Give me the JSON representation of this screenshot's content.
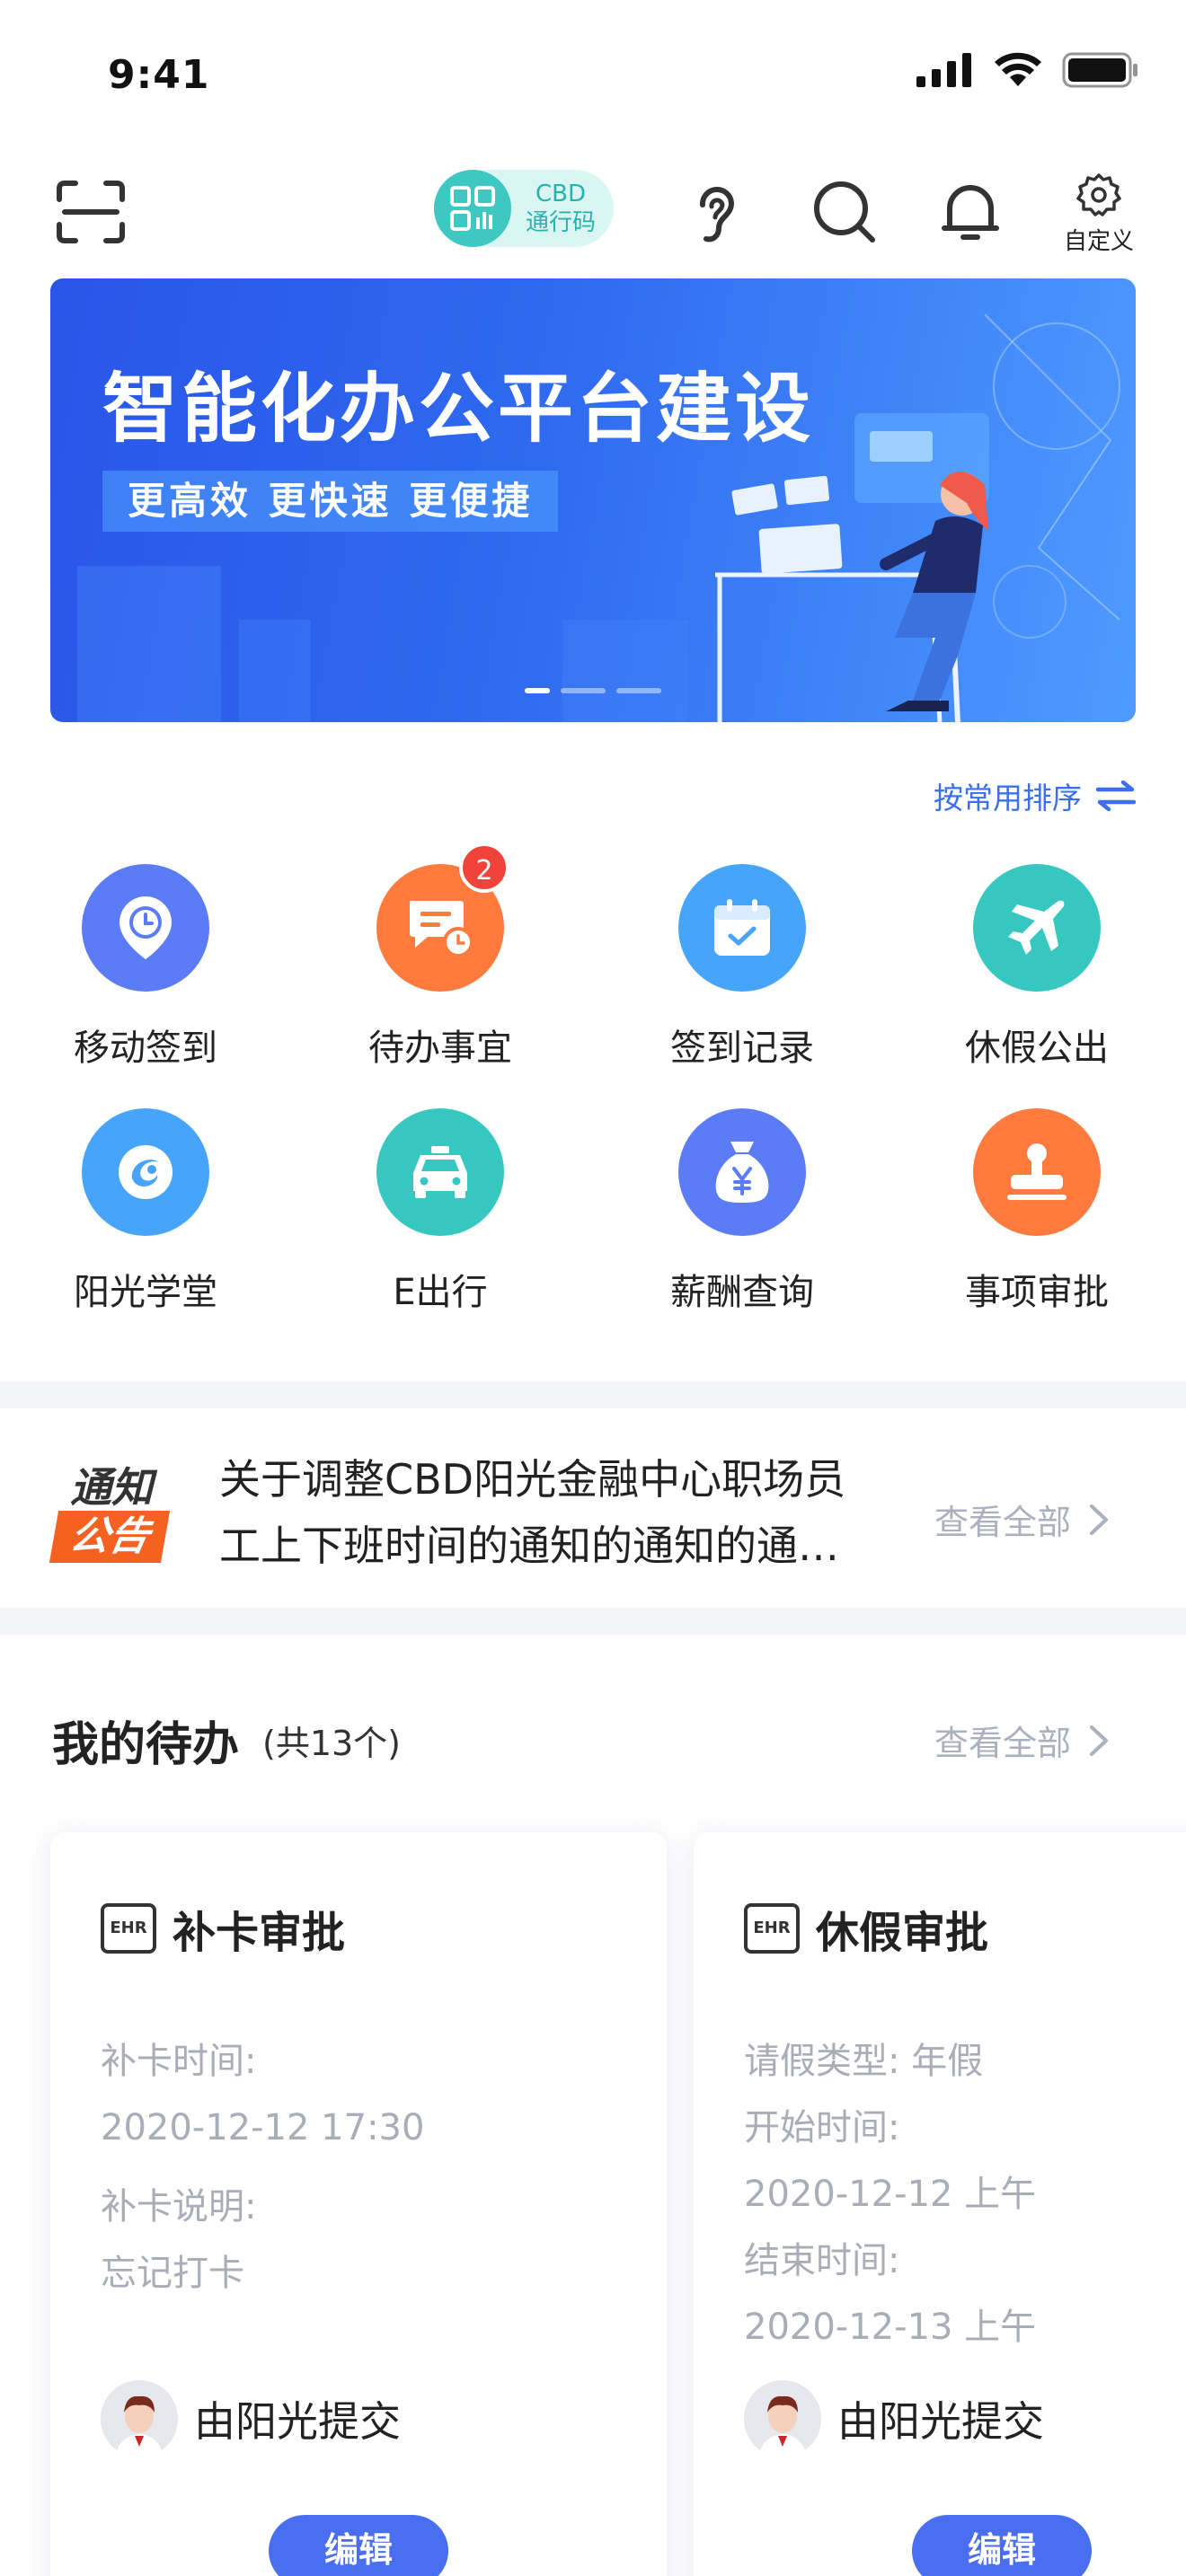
{
  "status_bar": {
    "time": "9:41"
  },
  "header": {
    "pass_badge": {
      "line1": "CBD",
      "line2": "通行码"
    },
    "custom_label": "自定义"
  },
  "banner": {
    "title": "智能化办公平台建设",
    "subtitle": "更高效 更快速 更便捷",
    "slides": 3,
    "active_slide": 1
  },
  "sort": {
    "label": "按常用排序"
  },
  "apps": [
    {
      "label": "移动签到",
      "icon": "location-clock-icon",
      "color": "#5b7cf6"
    },
    {
      "label": "待办事宜",
      "icon": "todo-message-icon",
      "color": "#ff7a3d",
      "badge": "2"
    },
    {
      "label": "签到记录",
      "icon": "calendar-check-icon",
      "color": "#46a4fb"
    },
    {
      "label": "休假公出",
      "icon": "airplane-icon",
      "color": "#35c7c0"
    },
    {
      "label": "阳光学堂",
      "icon": "sunshine-school-icon",
      "color": "#46a4fb"
    },
    {
      "label": "E出行",
      "icon": "taxi-icon",
      "color": "#35c7c0"
    },
    {
      "label": "薪酬查询",
      "icon": "money-bag-icon",
      "color": "#5b7cf6"
    },
    {
      "label": "事项审批",
      "icon": "stamp-icon",
      "color": "#ff7a3d"
    }
  ],
  "notice": {
    "logo_top": "通知",
    "logo_bottom": "公告",
    "line1": "关于调整CBD阳光金融中心职场员",
    "line2": "工上下班时间的通知的通知的通…",
    "view_all": "查看全部"
  },
  "todo": {
    "title": "我的待办",
    "count_text": "(共13个)",
    "view_all": "查看全部",
    "cards": [
      {
        "ehr": "EHR",
        "title": "补卡审批",
        "fields": [
          "补卡时间:",
          "2020-12-12 17:30",
          "补卡说明:",
          "忘记打卡"
        ],
        "submitter": "由阳光提交",
        "edit": "编辑"
      },
      {
        "ehr": "EHR",
        "title": "休假审批",
        "fields": [
          "请假类型:  年假",
          "开始时间:",
          "2020-12-12 上午",
          "结束时间:",
          "2020-12-13 上午"
        ],
        "submitter": "由阳光提交",
        "edit": "编辑"
      }
    ]
  },
  "colors": {
    "accent": "#3b6ff0",
    "teal": "#3ec8c2",
    "orange": "#f5611f",
    "badge_red": "#f0433a"
  }
}
